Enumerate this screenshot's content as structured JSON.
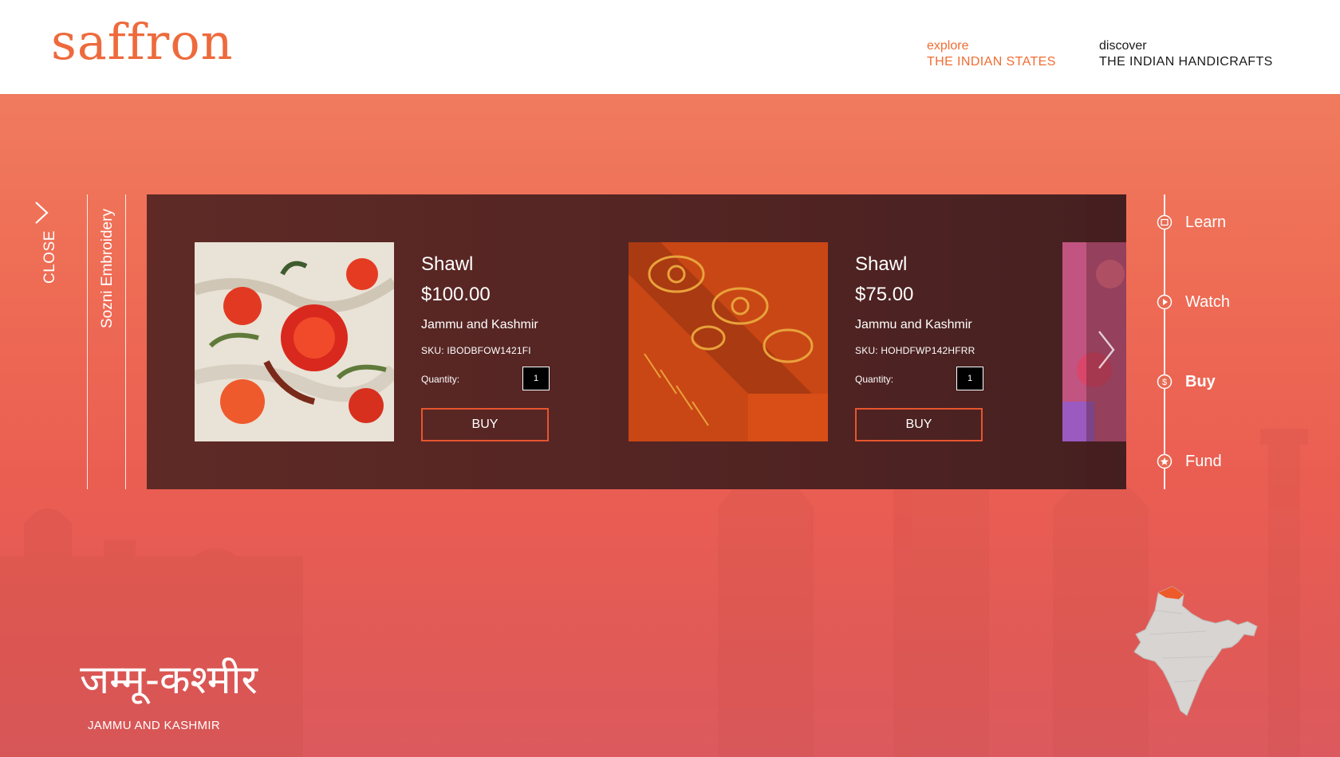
{
  "header": {
    "logo": "saffron",
    "nav": [
      {
        "small": "explore",
        "big": "THE INDIAN STATES",
        "color": "#f06d32"
      },
      {
        "small": "discover",
        "big": "THE INDIAN HANDICRAFTS",
        "color": "#1a1a1a"
      }
    ]
  },
  "close_label": "CLOSE",
  "category": "Sozni Embroidery",
  "products": [
    {
      "name": "Shawl",
      "price": "$100.00",
      "state": "Jammu and Kashmir",
      "sku": "SKU: IBODBFOW1421FI",
      "quantity_label": "Quantity:",
      "quantity": "1",
      "buy_label": "BUY"
    },
    {
      "name": "Shawl",
      "price": "$75.00",
      "state": "Jammu and Kashmir",
      "sku": "SKU: HOHDFWP142HFRR",
      "quantity_label": "Quantity:",
      "quantity": "1",
      "buy_label": "BUY"
    }
  ],
  "side_nav": [
    {
      "label": "Learn",
      "icon": "book-icon",
      "active": false
    },
    {
      "label": "Watch",
      "icon": "play-icon",
      "active": false
    },
    {
      "label": "Buy",
      "icon": "dollar-icon",
      "active": true
    },
    {
      "label": "Fund",
      "icon": "star-icon",
      "active": false
    }
  ],
  "state": {
    "hindi_name": "जम्मू-कश्मीर",
    "name": "JAMMU AND KASHMIR"
  },
  "colors": {
    "accent": "#f06d32",
    "button_border": "#e7552f",
    "panel": "#4f2322"
  }
}
